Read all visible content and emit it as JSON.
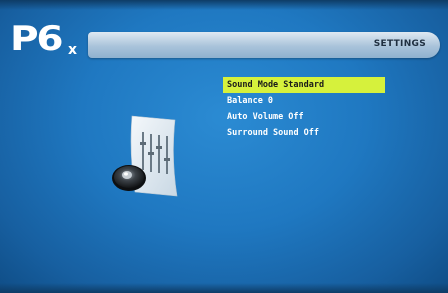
{
  "branding": {
    "logo": "P6",
    "logo_sub": "x"
  },
  "header": {
    "title": "SETTINGS"
  },
  "menu": {
    "items": [
      {
        "label": "Sound Mode",
        "value": "Standard",
        "selected": true
      },
      {
        "label": "Balance",
        "value": "0",
        "selected": false
      },
      {
        "label": "Auto Volume",
        "value": "Off",
        "selected": false
      },
      {
        "label": "Surround Sound",
        "value": "Off",
        "selected": false
      }
    ]
  },
  "colors": {
    "background": "#1f78c1",
    "highlight": "#d6f13c",
    "header_bar": "#a9c3da"
  },
  "icons": {
    "illustration": "speaker-equalizer-icon"
  }
}
